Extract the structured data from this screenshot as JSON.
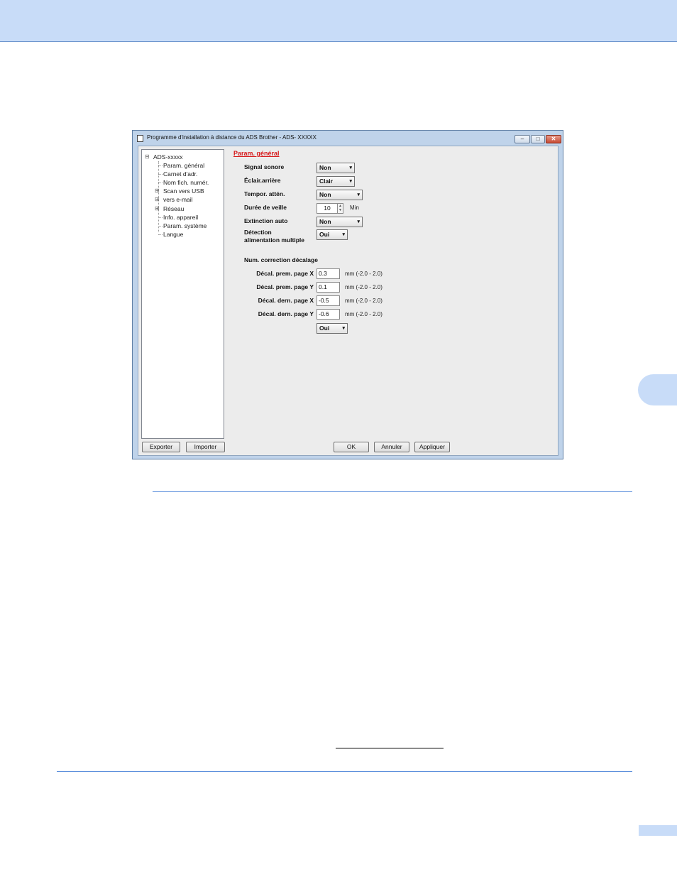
{
  "window": {
    "title": "Programme d'installation à distance du ADS Brother - ADS- XXXXX",
    "minimize": "–",
    "maximize": "□",
    "close": "✕"
  },
  "tree": {
    "root": "ADS-xxxxx",
    "items": [
      {
        "label": "Param. général",
        "expandable": false
      },
      {
        "label": "Carnet d'adr.",
        "expandable": false
      },
      {
        "label": "Nom fich. numér.",
        "expandable": false
      },
      {
        "label": "Scan vers USB",
        "expandable": true
      },
      {
        "label": "vers e-mail",
        "expandable": true
      },
      {
        "label": "Réseau",
        "expandable": true
      },
      {
        "label": "Info. appareil",
        "expandable": false
      },
      {
        "label": "Param. système",
        "expandable": false
      },
      {
        "label": "Langue",
        "expandable": false
      }
    ],
    "expand_symbol": "⊞",
    "collapse_symbol": "⊟"
  },
  "panel": {
    "title": "Param. général",
    "signal_sonore": {
      "label": "Signal sonore",
      "value": "Non"
    },
    "eclair": {
      "label": "Éclair.arrière",
      "value": "Clair"
    },
    "tempor": {
      "label": "Tempor. attén.",
      "value": "Non"
    },
    "veille": {
      "label": "Durée de veille",
      "value": "10",
      "unit": "Min"
    },
    "extinction": {
      "label": "Extinction auto",
      "value": "Non"
    },
    "detection": {
      "label_line1": "Détection",
      "label_line2": "alimentation multiple",
      "value": "Oui"
    },
    "offset_title": "Num. correction décalage",
    "offsets": [
      {
        "label": "Décal. prem. page X",
        "value": "0.3",
        "range": "mm (-2.0 - 2.0)"
      },
      {
        "label": "Décal. prem. page Y",
        "value": "0.1",
        "range": "mm (-2.0 - 2.0)"
      },
      {
        "label": "Décal. dern. page X",
        "value": "-0.5",
        "range": "mm (-2.0 - 2.0)"
      },
      {
        "label": "Décal. dern. page Y",
        "value": "-0.6",
        "range": "mm (-2.0 - 2.0)"
      }
    ],
    "bottom_combo": "Oui"
  },
  "buttons": {
    "exporter": "Exporter",
    "importer": "Importer",
    "ok": "OK",
    "annuler": "Annuler",
    "appliquer": "Appliquer"
  },
  "colors": {
    "header_band": "#c8dcf8",
    "rule": "#5b8fdc",
    "section_title": "#d6191b"
  }
}
